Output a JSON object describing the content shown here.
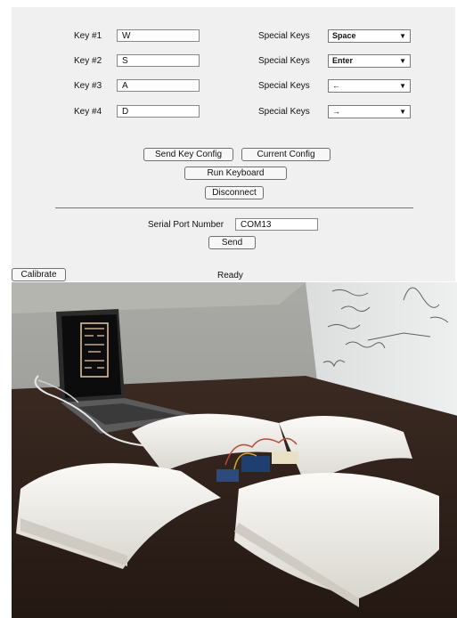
{
  "keys": [
    {
      "label": "Key #1",
      "value": "W",
      "special_label": "Special Keys",
      "special_value": "Space"
    },
    {
      "label": "Key #2",
      "value": "S",
      "special_label": "Special Keys",
      "special_value": "Enter"
    },
    {
      "label": "Key #3",
      "value": "A",
      "special_label": "Special Keys",
      "special_value": "←"
    },
    {
      "label": "Key #4",
      "value": "D",
      "special_label": "Special Keys",
      "special_value": "→"
    }
  ],
  "buttons": {
    "send_key_config": "Send Key Config",
    "current_config": "Current Config",
    "run_keyboard": "Run Keyboard",
    "disconnect": "Disconnect",
    "send": "Send",
    "calibrate": "Calibrate"
  },
  "serial": {
    "label": "Serial Port Number",
    "value": "COM13"
  },
  "status": "Ready",
  "icons": {
    "dropdown": "chevron-down-icon"
  }
}
